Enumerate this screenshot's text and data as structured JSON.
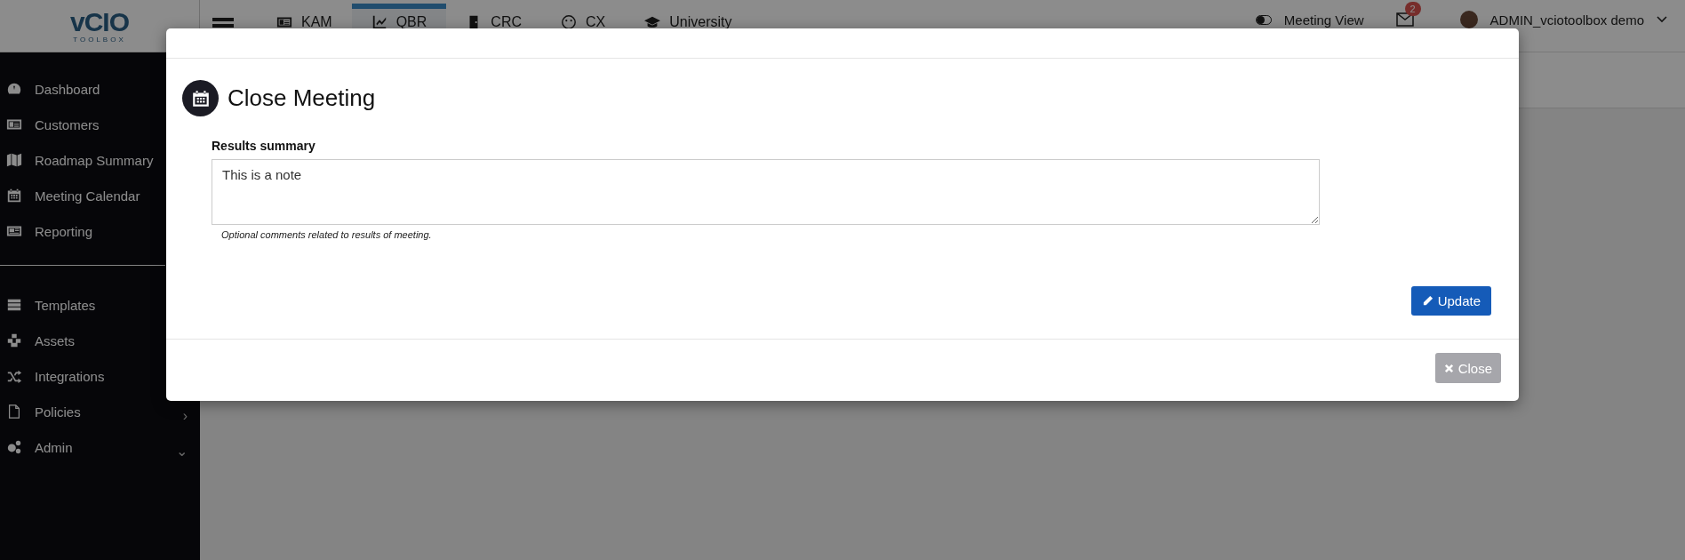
{
  "logo": {
    "mark": "vCIO",
    "subtitle": "TOOLBOX"
  },
  "top_nav": {
    "tabs": [
      {
        "label": "KAM",
        "selected": false
      },
      {
        "label": "QBR",
        "selected": true
      },
      {
        "label": "CRC",
        "selected": false
      },
      {
        "label": "CX",
        "selected": false
      },
      {
        "label": "University",
        "selected": false
      }
    ]
  },
  "header_right": {
    "meeting_view": "Meeting View",
    "notifications_badge": "2",
    "user_name": "ADMIN_vciotoolbox demo"
  },
  "sidebar": {
    "groups": [
      [
        {
          "label": "Dashboard"
        },
        {
          "label": "Customers"
        },
        {
          "label": "Roadmap Summary"
        },
        {
          "label": "Meeting Calendar"
        },
        {
          "label": "Reporting"
        }
      ],
      [
        {
          "label": "Templates"
        },
        {
          "label": "Assets"
        },
        {
          "label": "Integrations"
        },
        {
          "label": "Policies",
          "arrow": "›"
        },
        {
          "label": "Admin",
          "arrow": "⌄"
        }
      ]
    ]
  },
  "modal": {
    "title": "Close Meeting",
    "field_label": "Results summary",
    "field_value": "This is a note",
    "field_hint": "Optional comments related to results of meeting.",
    "update_button": "Update",
    "close_button": "Close"
  }
}
